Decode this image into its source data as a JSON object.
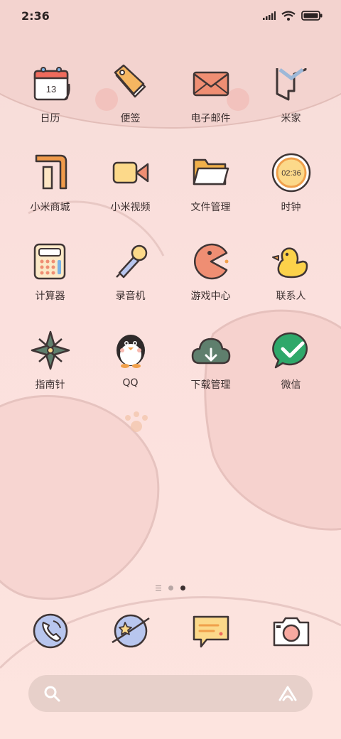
{
  "status_bar": {
    "time": "2:36",
    "icons": [
      "signal-icon",
      "wifi-icon",
      "battery-icon"
    ]
  },
  "apps": [
    {
      "label": "日历",
      "icon": "calendar-icon",
      "badge_text": "13"
    },
    {
      "label": "便签",
      "icon": "tag-icon"
    },
    {
      "label": "电子邮件",
      "icon": "envelope-icon"
    },
    {
      "label": "米家",
      "icon": "mijia-icon"
    },
    {
      "label": "小米商城",
      "icon": "mi-store-icon"
    },
    {
      "label": "小米视频",
      "icon": "video-camera-icon"
    },
    {
      "label": "文件管理",
      "icon": "folder-icon"
    },
    {
      "label": "时钟",
      "icon": "clock-icon",
      "clock_text": "02:36"
    },
    {
      "label": "计算器",
      "icon": "calculator-icon"
    },
    {
      "label": "录音机",
      "icon": "microphone-icon"
    },
    {
      "label": "游戏中心",
      "icon": "pacman-icon"
    },
    {
      "label": "联系人",
      "icon": "duck-icon"
    },
    {
      "label": "指南针",
      "icon": "compass-icon"
    },
    {
      "label": "QQ",
      "icon": "penguin-icon"
    },
    {
      "label": "下载管理",
      "icon": "cloud-download-icon"
    },
    {
      "label": "微信",
      "icon": "wechat-icon"
    }
  ],
  "pager": {
    "pages": 2,
    "active_index": 1
  },
  "dock": [
    {
      "icon": "phone-icon"
    },
    {
      "icon": "browser-planet-icon"
    },
    {
      "icon": "message-icon"
    },
    {
      "icon": "camera-icon"
    }
  ],
  "colors": {
    "background": "#fbe0dd",
    "accent_orange": "#f0a04b",
    "accent_yellow": "#fcd98a",
    "outline": "#3f3535",
    "wechat_green": "#2fa86a"
  }
}
